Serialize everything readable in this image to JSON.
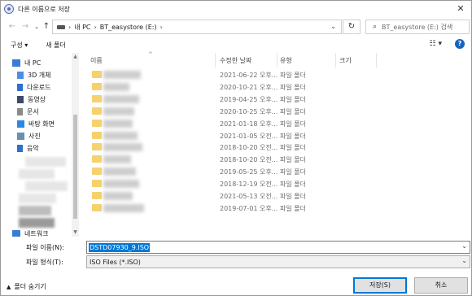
{
  "window": {
    "title": "다른 이름으로 저장",
    "close_glyph": "✕"
  },
  "nav": {
    "back_glyph": "←",
    "forward_glyph": "→",
    "down_glyph": "⌄",
    "up_glyph": "↑",
    "breadcrumb": [
      "내 PC",
      "BT_easystore (E:)"
    ],
    "separator": "›",
    "refresh_glyph": "↻",
    "search_placeholder": "BT_easystore (E:) 검색"
  },
  "toolbar": {
    "organize": "구성 ▾",
    "new_folder": "새 폴더",
    "view_glyph": "☷ ▾",
    "help_glyph": "?"
  },
  "sidebar": {
    "items": [
      {
        "label": "내 PC",
        "icon": "pc-icon",
        "color": "#3a7bd5"
      },
      {
        "label": "3D 개체",
        "icon": "3d-objects-icon",
        "color": "#4a90e2"
      },
      {
        "label": "다운로드",
        "icon": "download-icon",
        "color": "#2f6fd0"
      },
      {
        "label": "동영상",
        "icon": "video-icon",
        "color": "#3c4a66"
      },
      {
        "label": "문서",
        "icon": "document-icon",
        "color": "#8a8a8a"
      },
      {
        "label": "바탕 화면",
        "icon": "desktop-icon",
        "color": "#2a8ae0"
      },
      {
        "label": "사진",
        "icon": "pictures-icon",
        "color": "#6a8fb0"
      },
      {
        "label": "음악",
        "icon": "music-icon",
        "color": "#2f6fd0"
      }
    ],
    "network": {
      "label": "네트워크",
      "icon": "network-icon",
      "color": "#3a7bd5"
    }
  },
  "columns": {
    "name": "이름",
    "modified": "수정한 날짜",
    "type": "유형",
    "size": "크기"
  },
  "files": [
    {
      "date": "2021-06-22 오후...",
      "type": "파일 폴더"
    },
    {
      "date": "2020-10-21 오후...",
      "type": "파일 폴더"
    },
    {
      "date": "2019-04-25 오후...",
      "type": "파일 폴더"
    },
    {
      "date": "2020-10-25 오후...",
      "type": "파일 폴더"
    },
    {
      "date": "2021-01-18 오후...",
      "type": "파일 폴더"
    },
    {
      "date": "2021-01-05 오전...",
      "type": "파일 폴더"
    },
    {
      "date": "2018-10-20 오전...",
      "type": "파일 폴더"
    },
    {
      "date": "2018-10-20 오전...",
      "type": "파일 폴더"
    },
    {
      "date": "2019-05-25 오후...",
      "type": "파일 폴더"
    },
    {
      "date": "2018-12-19 오전...",
      "type": "파일 폴더"
    },
    {
      "date": "2021-05-13 오전...",
      "type": "파일 폴더"
    },
    {
      "date": "2019-07-01 오후...",
      "type": "파일 폴더"
    }
  ],
  "form": {
    "filename_label": "파일 이름(N):",
    "filename_value": "DSTD07930_9.ISO",
    "filetype_label": "파일 형식(T):",
    "filetype_value": "ISO Files (*.ISO)"
  },
  "footer": {
    "hide_folders": "폴더 숨기기",
    "save": "저장(S)",
    "cancel": "취소"
  }
}
